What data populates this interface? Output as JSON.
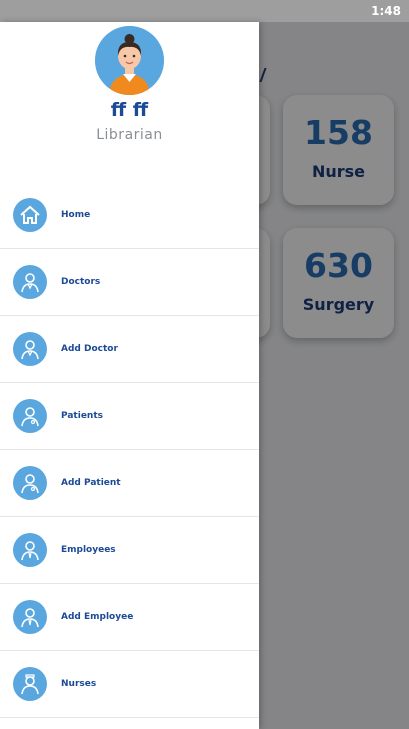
{
  "status_bar": {
    "time": "1:48"
  },
  "background": {
    "cards": [
      {
        "value": "158",
        "label": "Nurse"
      },
      {
        "value": "630",
        "label": "Surgery"
      }
    ]
  },
  "drawer": {
    "user": {
      "name": "ff ff",
      "role": "Librarian"
    },
    "menu": [
      {
        "label": "Home",
        "icon": "home-icon"
      },
      {
        "label": "Doctors",
        "icon": "doctor-icon"
      },
      {
        "label": "Add Doctor",
        "icon": "doctor-icon"
      },
      {
        "label": "Patients",
        "icon": "patient-icon"
      },
      {
        "label": "Add Patient",
        "icon": "patient-icon"
      },
      {
        "label": "Employees",
        "icon": "employee-icon"
      },
      {
        "label": "Add Employee",
        "icon": "employee-icon"
      },
      {
        "label": "Nurses",
        "icon": "nurse-icon"
      }
    ]
  },
  "colors": {
    "primary": "#1d4a96",
    "accent": "#5aa7e0",
    "number": "#2d6fb8"
  }
}
